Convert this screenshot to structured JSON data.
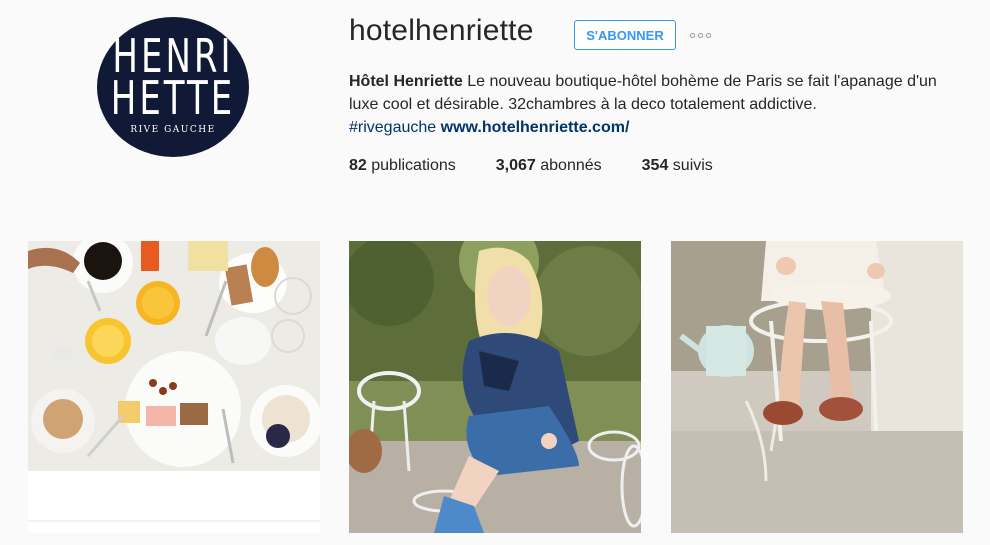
{
  "profile": {
    "avatar_line1": "HENRI",
    "avatar_line2": "HETTE",
    "avatar_line3": "RIVE GAUCHE",
    "username": "hotelhenriette",
    "follow_label": "S'ABONNER",
    "more_icon": "more-dots-icon",
    "bio_name": "Hôtel Henriette",
    "bio_text": " Le nouveau boutique-hôtel bohème de Paris se fait l'apanage d'un luxe cool et désirable. 32chambres à la deco totalement addictive.",
    "hashtag": "#rivegauche",
    "website": "www.hotelhenriette.com/"
  },
  "stats": {
    "posts_count": "82",
    "posts_label": " publications",
    "followers_count": "3,067",
    "followers_label": " abonnés",
    "following_count": "354",
    "following_label": " suivis"
  },
  "colors": {
    "accent": "#3897f0",
    "link": "#003569",
    "avatar_bg": "#101935"
  }
}
